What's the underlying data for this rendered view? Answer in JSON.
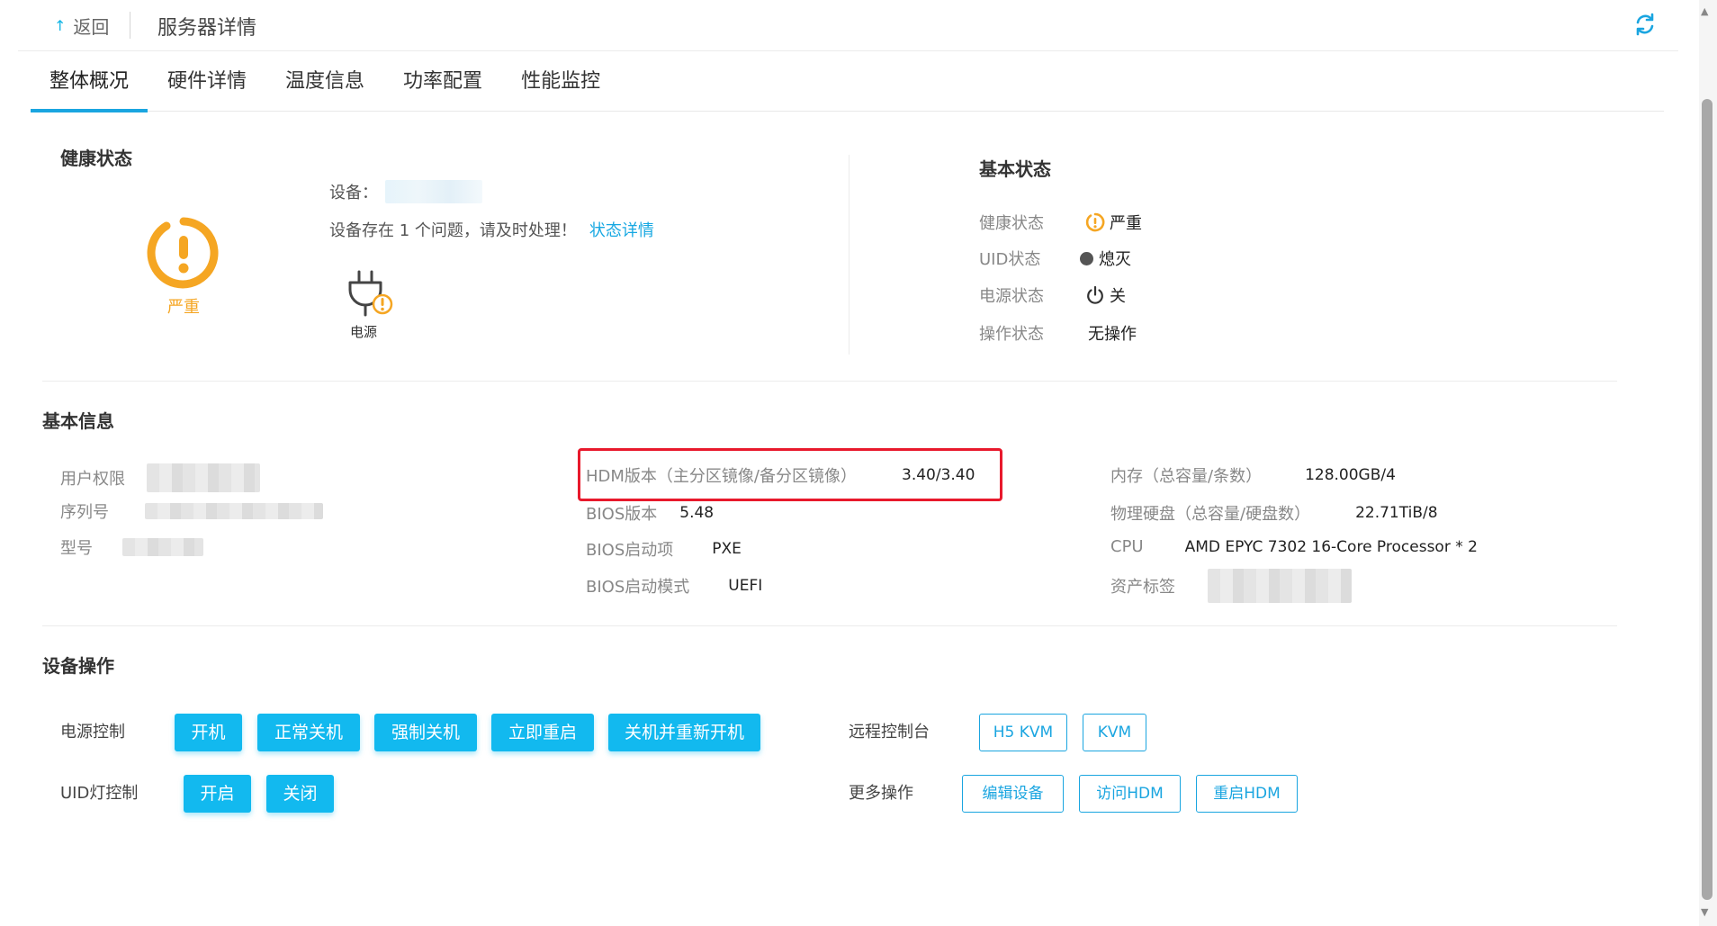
{
  "header": {
    "back_label": "返回",
    "title": "服务器详情"
  },
  "tabs": [
    {
      "label": "整体概况",
      "active": true
    },
    {
      "label": "硬件详情",
      "active": false
    },
    {
      "label": "温度信息",
      "active": false
    },
    {
      "label": "功率配置",
      "active": false
    },
    {
      "label": "性能监控",
      "active": false
    }
  ],
  "health": {
    "title": "健康状态",
    "severity_label": "严重",
    "device_label": "设备：",
    "issue_text": "设备存在 1 个问题，请及时处理！",
    "detail_link": "状态详情",
    "component_label": "电源",
    "severity_color": "#f5a623"
  },
  "basic_status": {
    "title": "基本状态",
    "rows": [
      {
        "key": "健康状态",
        "value": "严重",
        "icon": "warning-icon"
      },
      {
        "key": "UID状态",
        "value": "熄灭",
        "icon": "dot-icon"
      },
      {
        "key": "电源状态",
        "value": "关",
        "icon": "power-icon"
      },
      {
        "key": "操作状态",
        "value": "无操作",
        "icon": ""
      }
    ]
  },
  "basic_info": {
    "title": "基本信息",
    "col1": [
      {
        "key": "用户权限"
      },
      {
        "key": "序列号"
      },
      {
        "key": "型号"
      }
    ],
    "col2": [
      {
        "key": "HDM版本（主分区镜像/备分区镜像）",
        "value": "3.40/3.40"
      },
      {
        "key": "BIOS版本",
        "value": "5.48"
      },
      {
        "key": "BIOS启动项",
        "value": "PXE"
      },
      {
        "key": "BIOS启动模式",
        "value": "UEFI"
      }
    ],
    "col3": [
      {
        "key": "内存（总容量/条数）",
        "value": "128.00GB/4"
      },
      {
        "key": "物理硬盘（总容量/硬盘数）",
        "value": "22.71TiB/8"
      },
      {
        "key": "CPU",
        "value": "AMD EPYC 7302 16-Core Processor * 2"
      },
      {
        "key": "资产标签",
        "value": ""
      }
    ]
  },
  "operations": {
    "title": "设备操作",
    "power_label": "电源控制",
    "power_buttons": [
      "开机",
      "正常关机",
      "强制关机",
      "立即重启",
      "关机并重新开机"
    ],
    "uid_label": "UID灯控制",
    "uid_buttons": [
      "开启",
      "关闭"
    ],
    "console_label": "远程控制台",
    "console_buttons": [
      "H5 KVM",
      "KVM"
    ],
    "more_label": "更多操作",
    "more_buttons": [
      "编辑设备",
      "访问HDM",
      "重启HDM"
    ]
  },
  "colors": {
    "accent": "#12b9ef",
    "tab_underline": "#1aa5e0",
    "warning": "#f5a623",
    "highlight_border": "#e8192c"
  }
}
